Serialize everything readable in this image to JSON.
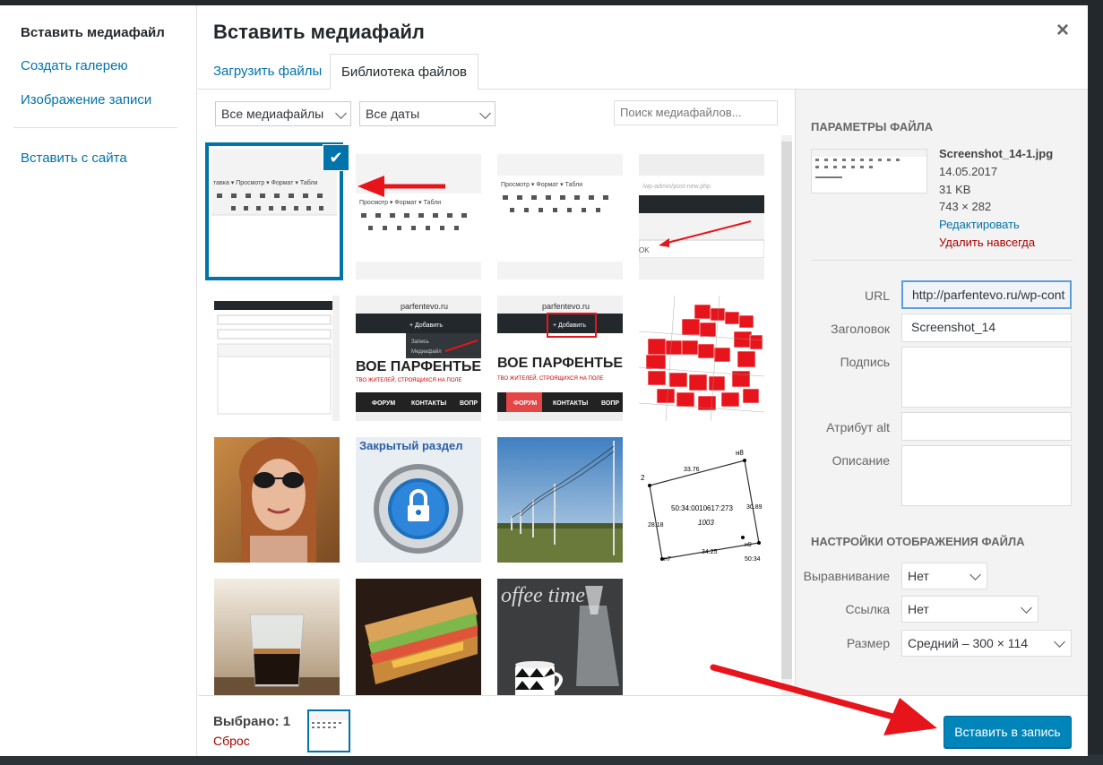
{
  "menu": {
    "items": [
      {
        "label": "Вставить медиафайл",
        "active": true
      },
      {
        "label": "Создать галерею",
        "active": false
      },
      {
        "label": "Изображение записи",
        "active": false
      },
      {
        "label": "Вставить с сайта",
        "active": false
      }
    ]
  },
  "header": {
    "title": "Вставить медиафайл",
    "close_icon": "×",
    "tabs": [
      {
        "label": "Загрузить файлы",
        "active": false
      },
      {
        "label": "Библиотека файлов",
        "active": true
      }
    ]
  },
  "toolbar": {
    "filter_media": "Все медиафайлы",
    "filter_dates": "Все даты",
    "search_placeholder": "Поиск медиафайлов..."
  },
  "grid": {
    "items": [
      {
        "type": "editor-toolbar-screenshot",
        "selected": true
      },
      {
        "type": "editor-toolbar-screenshot-arrow"
      },
      {
        "type": "editor-toolbar-screenshot"
      },
      {
        "type": "url-screenshot-arrow"
      },
      {
        "type": "admin-screenshot"
      },
      {
        "type": "site-add-menu-screenshot"
      },
      {
        "type": "site-add-button-screenshot"
      },
      {
        "type": "cadastral-map-red"
      },
      {
        "type": "photo-woman-sunglasses"
      },
      {
        "type": "closed-section-lock",
        "caption": "Закрытый раздел"
      },
      {
        "type": "photo-power-lines"
      },
      {
        "type": "land-plot-plan"
      },
      {
        "type": "photo-coffee-glass"
      },
      {
        "type": "photo-sandwich"
      },
      {
        "type": "photo-coffee-time"
      }
    ],
    "texts": {
      "site_domain": "parfentevo.ru",
      "add_label": "+ Добавить",
      "menu_record": "Запись",
      "menu_media": "Медиафайл",
      "banner_big": "ВОЕ ПАРФЕНТЬЕВО",
      "banner_small": "ТВО ЖИТЕЛЕЙ, СТРОЯЩИХСЯ НА ПОЛЕ",
      "nav_forum": "ФОРУМ",
      "nav_contacts": "КОНТАКТЫ",
      "nav_more": "ВОПР",
      "plot_number": "50:34:0010617:273",
      "plot_area": "1003",
      "plot_n8": "н8",
      "plot_n7": "н7",
      "plot_n9": "н9",
      "plot_2": "2",
      "plot_d1": "33.76",
      "plot_d2": "30.89",
      "plot_d3": "28.18",
      "plot_d4": "34.25",
      "plot_5034": "50:34",
      "coffee_text": "offee time",
      "toolbar_labels": "Просмотр ▾   Формат ▾   Табли"
    }
  },
  "sidebar": {
    "heading_params": "Параметры файла",
    "file_name": "Screenshot_14-1.jpg",
    "file_date": "14.05.2017",
    "file_size": "31 KB",
    "file_dimensions": "743 × 282",
    "edit_link": "Редактировать",
    "delete_link": "Удалить навсегда",
    "fields": {
      "url_label": "URL",
      "url_value": "http://parfentevo.ru/wp-cont",
      "title_label": "Заголовок",
      "title_value": "Screenshot_14",
      "caption_label": "Подпись",
      "alt_label": "Атрибут alt",
      "description_label": "Описание"
    },
    "heading_display": "Настройки отображения файла",
    "display": {
      "align_label": "Выравнивание",
      "align_value": "Нет",
      "link_label": "Ссылка",
      "link_value": "Нет",
      "size_label": "Размер",
      "size_value": "Средний – 300 × 114"
    }
  },
  "footer": {
    "selected_label": "Выбрано: 1",
    "reset_label": "Сброс",
    "insert_button": "Вставить в запись"
  },
  "colors": {
    "accent": "#0073aa",
    "danger": "#a00",
    "annotation_red": "#e8141b"
  }
}
